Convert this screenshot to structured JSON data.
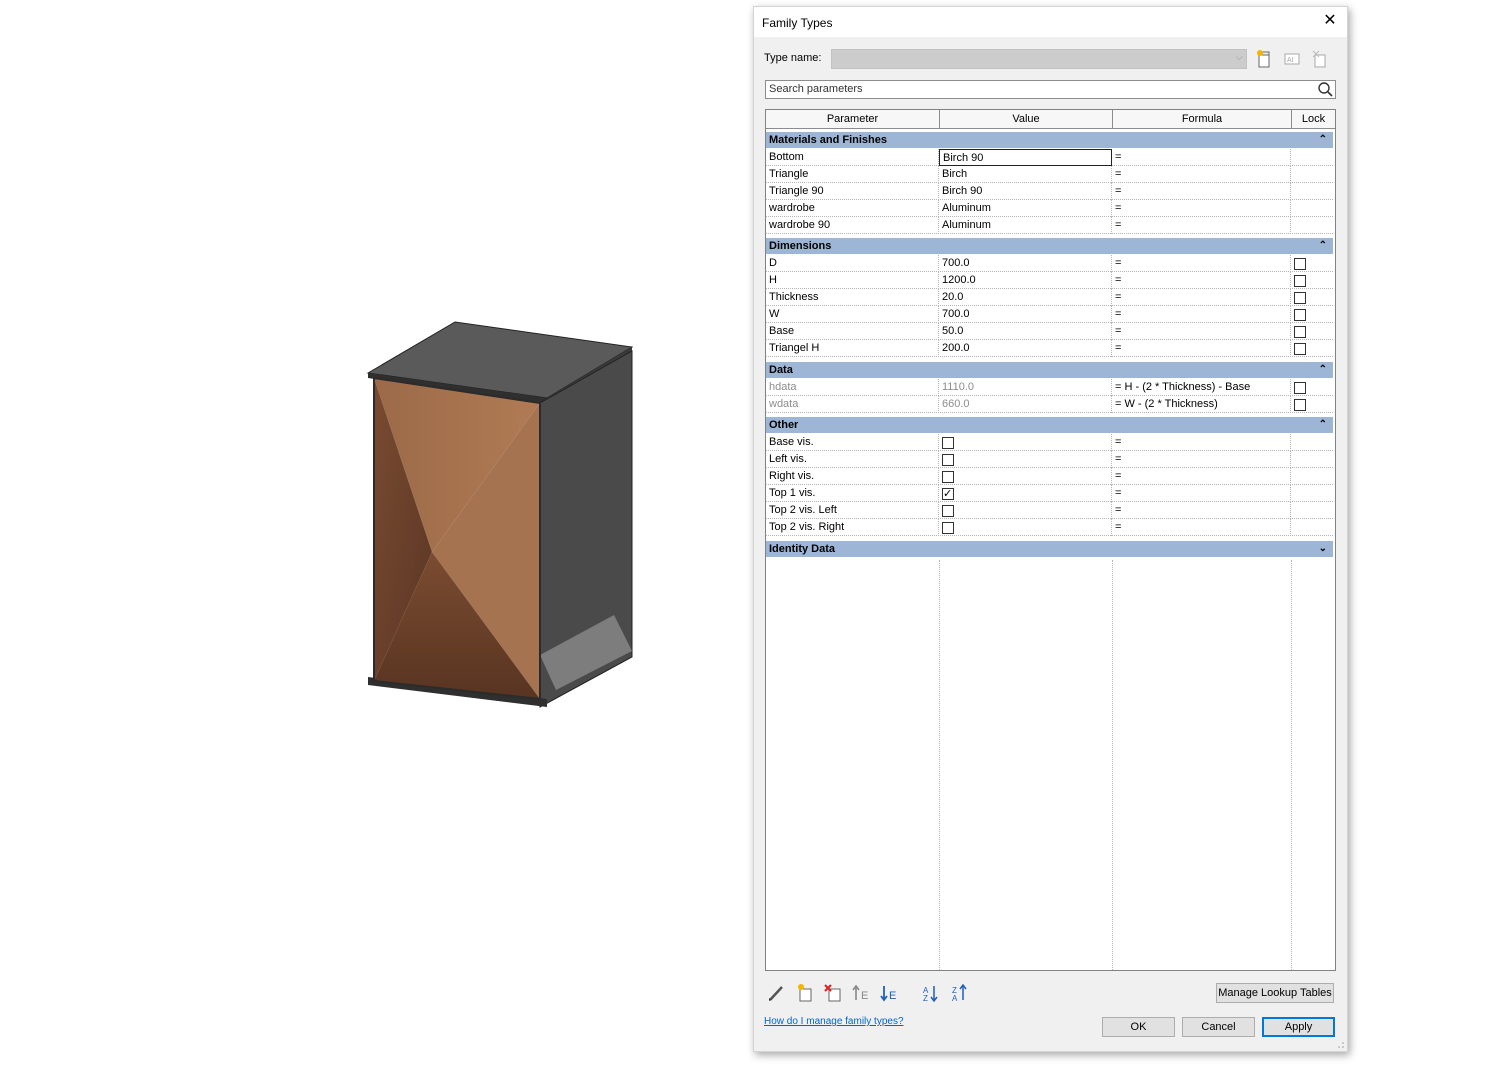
{
  "dialog": {
    "title": "Family Types",
    "type_name_label": "Type name:",
    "type_name_value": "",
    "search_placeholder": "Search parameters",
    "columns": [
      "Parameter",
      "Value",
      "Formula",
      "Lock"
    ],
    "groups": {
      "materials": {
        "label": "Materials and Finishes",
        "rows": [
          {
            "param": "Bottom",
            "value": "Birch 90",
            "formula": "="
          },
          {
            "param": "Triangle",
            "value": "Birch",
            "formula": "="
          },
          {
            "param": "Triangle 90",
            "value": "Birch 90",
            "formula": "="
          },
          {
            "param": "wardrobe",
            "value": "Aluminum",
            "formula": "="
          },
          {
            "param": "wardrobe 90",
            "value": "Aluminum",
            "formula": "="
          }
        ]
      },
      "dimensions": {
        "label": "Dimensions",
        "rows": [
          {
            "param": "D",
            "value": "700.0",
            "formula": "=",
            "lock": false
          },
          {
            "param": "H",
            "value": "1200.0",
            "formula": "=",
            "lock": false
          },
          {
            "param": "Thickness",
            "value": "20.0",
            "formula": "=",
            "lock": false
          },
          {
            "param": "W",
            "value": "700.0",
            "formula": "=",
            "lock": false
          },
          {
            "param": "Base",
            "value": "50.0",
            "formula": "=",
            "lock": false
          },
          {
            "param": "Triangel H",
            "value": "200.0",
            "formula": "=",
            "lock": false
          }
        ]
      },
      "data": {
        "label": "Data",
        "rows": [
          {
            "param": "hdata",
            "value": "1110.0",
            "formula": "= H - (2 * Thickness) - Base",
            "lock": false
          },
          {
            "param": "wdata",
            "value": "660.0",
            "formula": "= W - (2 * Thickness)",
            "lock": false
          }
        ]
      },
      "other": {
        "label": "Other",
        "rows": [
          {
            "param": "Base vis.",
            "checked": false,
            "formula": "="
          },
          {
            "param": "Left vis.",
            "checked": false,
            "formula": "="
          },
          {
            "param": "Right vis.",
            "checked": false,
            "formula": "="
          },
          {
            "param": "Top 1 vis.",
            "checked": true,
            "formula": "="
          },
          {
            "param": "Top 2 vis. Left",
            "checked": false,
            "formula": "="
          },
          {
            "param": "Top 2 vis. Right",
            "checked": false,
            "formula": "="
          }
        ]
      },
      "identity": {
        "label": "Identity Data"
      }
    },
    "manage_lookup_label": "Manage Lookup Tables",
    "help_link": "How do I manage family types?",
    "buttons": {
      "ok": "OK",
      "cancel": "Cancel",
      "apply": "Apply"
    }
  },
  "colors": {
    "group_header": "#9db6d6",
    "accent": "#0078d7",
    "wood": "#8a5a3b",
    "steel": "#5c5c5c"
  }
}
